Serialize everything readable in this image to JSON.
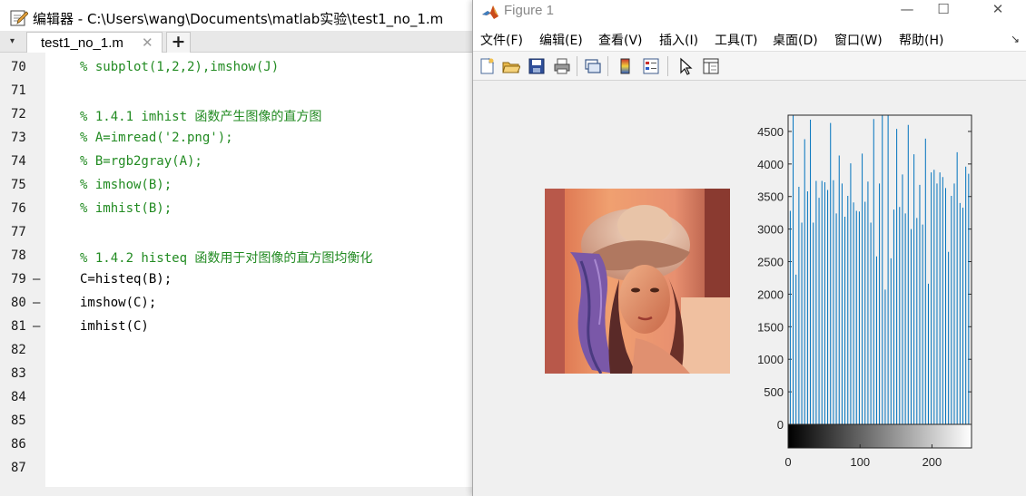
{
  "editor": {
    "title": "编辑器 - C:\\Users\\wang\\Documents\\matlab实验\\test1_no_1.m",
    "tab_label": "test1_no_1.m",
    "tab_close": "✕",
    "tab_add": "+",
    "lines": [
      {
        "num": "70",
        "bp": "",
        "text": "% subplot(1,2,2),imshow(J)",
        "kind": "comment"
      },
      {
        "num": "71",
        "bp": "",
        "text": "",
        "kind": "comment"
      },
      {
        "num": "72",
        "bp": "",
        "text": "% 1.4.1 imhist 函数产生图像的直方图",
        "kind": "comment"
      },
      {
        "num": "73",
        "bp": "",
        "text": "% A=imread('2.png');",
        "kind": "comment"
      },
      {
        "num": "74",
        "bp": "",
        "text": "% B=rgb2gray(A);",
        "kind": "comment"
      },
      {
        "num": "75",
        "bp": "",
        "text": "% imshow(B);",
        "kind": "comment"
      },
      {
        "num": "76",
        "bp": "",
        "text": "% imhist(B);",
        "kind": "comment"
      },
      {
        "num": "77",
        "bp": "",
        "text": "",
        "kind": "comment"
      },
      {
        "num": "78",
        "bp": "",
        "text": "% 1.4.2 histeq 函数用于对图像的直方图均衡化",
        "kind": "comment"
      },
      {
        "num": "79",
        "bp": "—",
        "text": "C=histeq(B);",
        "kind": "stmt"
      },
      {
        "num": "80",
        "bp": "—",
        "text": "imshow(C);",
        "kind": "stmt"
      },
      {
        "num": "81",
        "bp": "—",
        "text": "imhist(C)",
        "kind": "stmt"
      },
      {
        "num": "82",
        "bp": "",
        "text": "",
        "kind": "comment"
      },
      {
        "num": "83",
        "bp": "",
        "text": "",
        "kind": "comment"
      },
      {
        "num": "84",
        "bp": "",
        "text": "",
        "kind": "comment"
      },
      {
        "num": "85",
        "bp": "",
        "text": "",
        "kind": "comment"
      },
      {
        "num": "86",
        "bp": "",
        "text": "",
        "kind": "comment"
      },
      {
        "num": "87",
        "bp": "",
        "text": "",
        "kind": "comment"
      }
    ]
  },
  "figure": {
    "title": "Figure 1",
    "window_controls": [
      "—",
      "☐",
      "✕"
    ],
    "menu": [
      "文件(F)",
      "编辑(E)",
      "查看(V)",
      "插入(I)",
      "工具(T)",
      "桌面(D)",
      "窗口(W)",
      "帮助(H)"
    ],
    "menu_more": "↘",
    "toolbar_icons": [
      "new-figure-icon",
      "open-file-icon",
      "save-icon",
      "print-icon",
      "link-plot-icon",
      "colorbar-icon",
      "legend-icon",
      "pointer-icon",
      "property-editor-icon"
    ]
  },
  "chart_data": {
    "type": "bar",
    "title": "",
    "xlabel": "",
    "ylabel": "",
    "xlim": [
      0,
      255
    ],
    "ylim": [
      0,
      4750
    ],
    "yticks": [
      0,
      500,
      1000,
      1500,
      2000,
      2500,
      3000,
      3500,
      4000,
      4500
    ],
    "xticks": [
      0,
      100,
      200
    ],
    "colorbar": "gray",
    "stem_color": "#0072bd",
    "x": [
      3,
      7,
      11,
      15,
      19,
      23,
      27,
      31,
      35,
      39,
      43,
      47,
      51,
      55,
      59,
      63,
      67,
      71,
      75,
      79,
      83,
      87,
      91,
      95,
      99,
      103,
      107,
      111,
      115,
      119,
      123,
      127,
      131,
      135,
      139,
      143,
      147,
      151,
      155,
      159,
      163,
      167,
      171,
      175,
      179,
      183,
      187,
      191,
      195,
      199,
      203,
      207,
      211,
      215,
      219,
      223,
      227,
      231,
      235,
      239,
      243,
      247,
      251
    ],
    "values": [
      3280,
      4750,
      2300,
      3650,
      3100,
      4380,
      3580,
      4680,
      3100,
      3740,
      3480,
      3740,
      3720,
      3600,
      4630,
      3750,
      3240,
      4130,
      3700,
      3190,
      3510,
      4010,
      3410,
      3280,
      3270,
      4160,
      3420,
      3730,
      3100,
      4690,
      2580,
      3700,
      4750,
      2070,
      4750,
      2550,
      3300,
      4540,
      3340,
      3840,
      3240,
      4600,
      3000,
      4150,
      3170,
      3680,
      3070,
      4390,
      2160,
      3870,
      3910,
      3700,
      3870,
      3800,
      3630,
      2650,
      3510,
      3700,
      4180,
      3400,
      3330,
      3960,
      3850
    ]
  }
}
